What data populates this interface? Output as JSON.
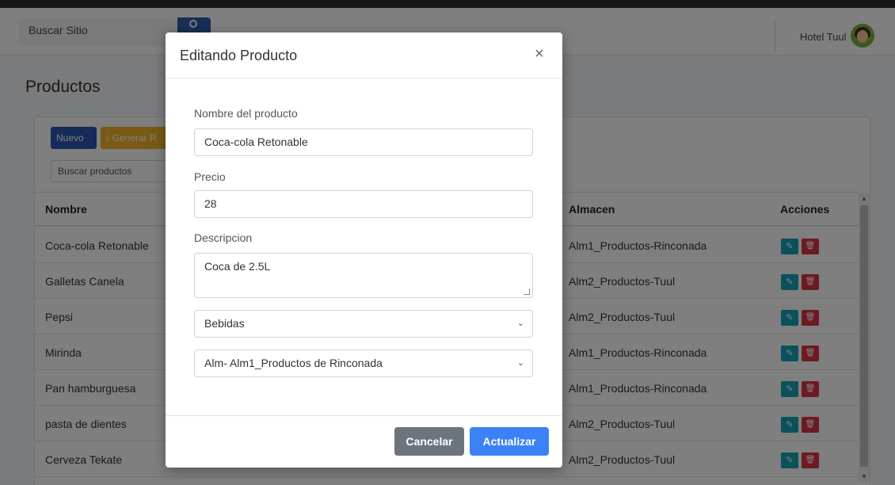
{
  "navbar": {
    "search_placeholder": "Buscar Sitio",
    "hotel_name": "Hotel Tuul"
  },
  "page": {
    "title": "Productos",
    "new_button": "Nuevo",
    "report_button": "⤓ Generar R",
    "search_placeholder": "Buscar productos"
  },
  "table": {
    "headers": {
      "name": "Nombre",
      "warehouse": "Almacen",
      "actions": "Acciones"
    },
    "rows": [
      {
        "name": "Coca-cola Retonable",
        "warehouse": "Alm1_Productos-Rinconada"
      },
      {
        "name": "Galletas Canela",
        "warehouse": "Alm2_Productos-Tuul"
      },
      {
        "name": "Pepsi",
        "warehouse": "Alm2_Productos-Tuul"
      },
      {
        "name": "Mirinda",
        "warehouse": "Alm1_Productos-Rinconada"
      },
      {
        "name": "Pan hamburguesa",
        "warehouse": "Alm1_Productos-Rinconada"
      },
      {
        "name": "pasta de dientes",
        "warehouse": "Alm2_Productos-Tuul"
      },
      {
        "name": "Cerveza Tekate",
        "warehouse": "Alm2_Productos-Tuul"
      }
    ]
  },
  "modal": {
    "title": "Editando Producto",
    "close": "×",
    "name_label": "Nombre del producto",
    "name_value": "Coca-cola Retonable",
    "price_label": "Precio",
    "price_value": "28",
    "description_label": "Descripcion",
    "description_value": "Coca de 2.5L",
    "category_value": "Bebidas",
    "warehouse_value": "Alm- Alm1_Productos de Rinconada",
    "cancel_button": "Cancelar",
    "update_button": "Actualizar"
  },
  "colors": {
    "primary": "#2f56b0",
    "warning": "#f0b429",
    "edit": "#17a2b8",
    "delete": "#dc3545",
    "update": "#3b82f6",
    "cancel": "#6c757d"
  },
  "icons": {
    "search": "search-icon",
    "edit": "edit-icon",
    "delete": "trash-icon",
    "close": "close-icon",
    "dropdown": "chevron-down-icon"
  }
}
